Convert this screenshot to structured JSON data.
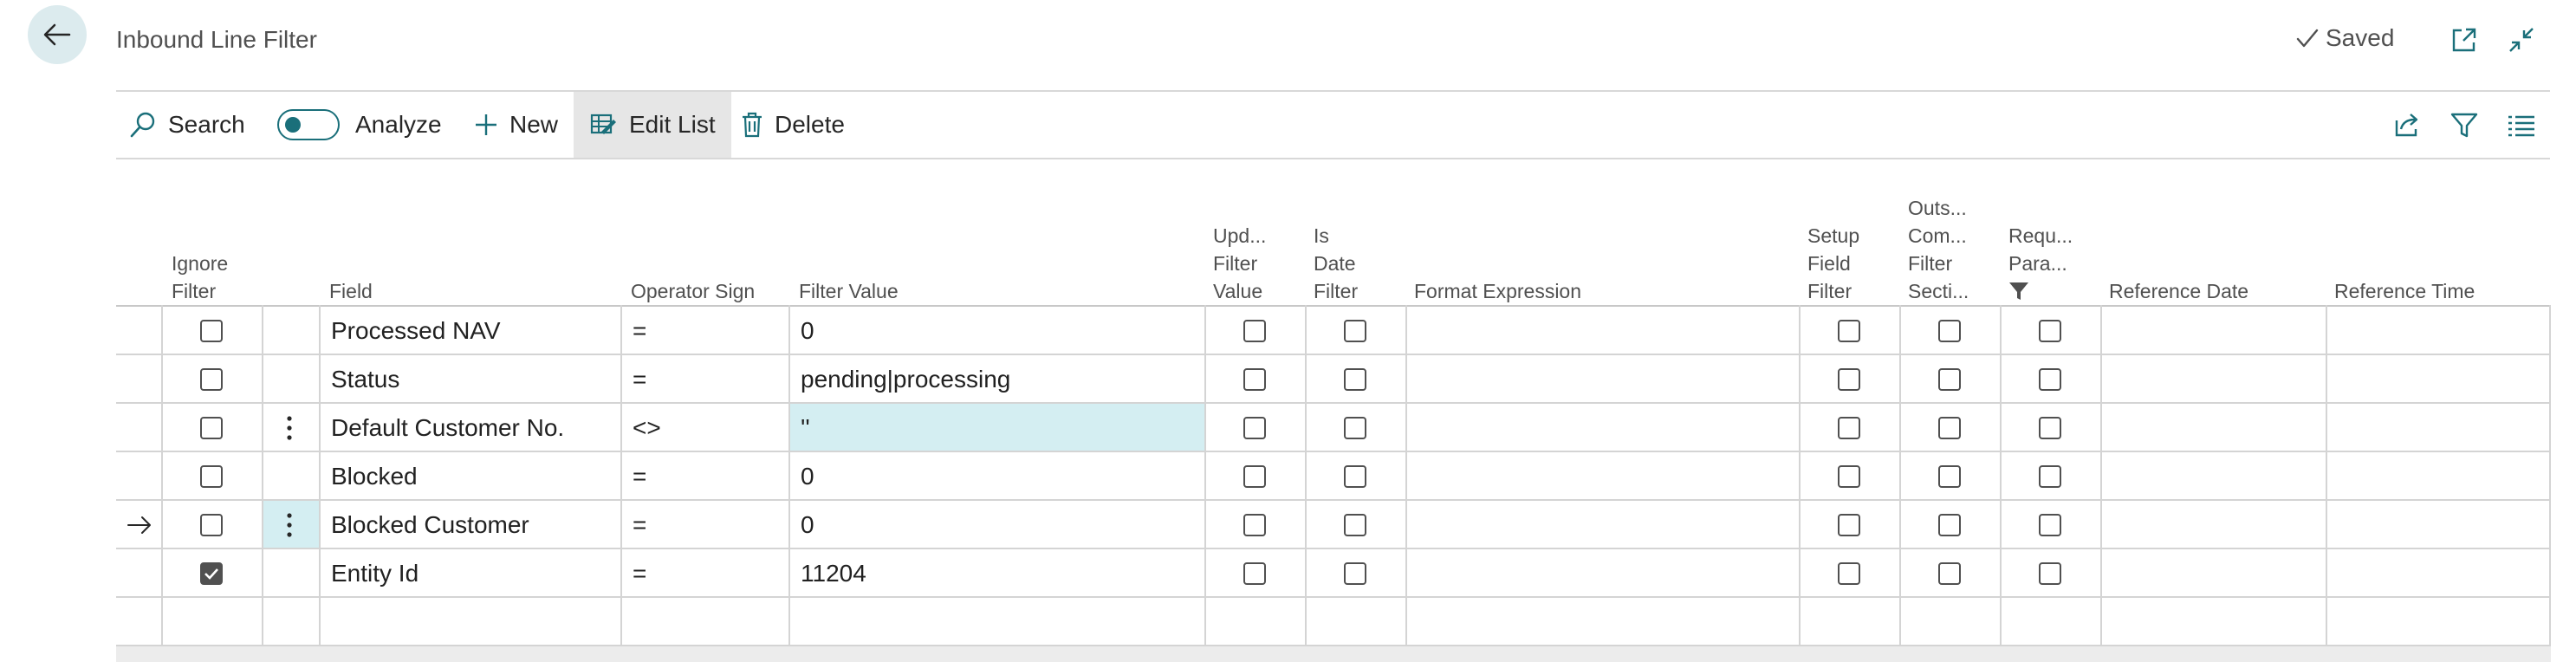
{
  "header": {
    "title": "Inbound Line Filter",
    "saved_label": "Saved"
  },
  "toolbar": {
    "search_label": "Search",
    "analyze_label": "Analyze",
    "new_label": "New",
    "edit_list_label": "Edit List",
    "delete_label": "Delete"
  },
  "columns": {
    "ignore_filter": [
      "Ignore",
      "Filter"
    ],
    "field": [
      "Field"
    ],
    "operator_sign": [
      "Operator Sign"
    ],
    "filter_value": [
      "Filter Value"
    ],
    "upd_filter_value": [
      "Upd...",
      "Filter",
      "Value"
    ],
    "is_date_filter": [
      "Is",
      "Date",
      "Filter"
    ],
    "format_expression": [
      "Format Expression"
    ],
    "setup_field_filter": [
      "Setup",
      "Field",
      "Filter"
    ],
    "outs_com_filter": [
      "Outs...",
      "Com...",
      "Filter",
      "Secti..."
    ],
    "requ_para": [
      "Requ...",
      "Para..."
    ],
    "reference_date": [
      "Reference Date"
    ],
    "reference_time": [
      "Reference Time"
    ]
  },
  "rows": [
    {
      "field": "Processed NAV",
      "operator": "=",
      "filter_value": "0",
      "ignore_filter": false,
      "current": false,
      "selected": false
    },
    {
      "field": "Status",
      "operator": "=",
      "filter_value": "pending|processing",
      "ignore_filter": false,
      "current": false,
      "selected": false
    },
    {
      "field": "Default Customer No.",
      "operator": "<>",
      "filter_value": "''",
      "ignore_filter": false,
      "current": false,
      "selected": true
    },
    {
      "field": "Blocked",
      "operator": "=",
      "filter_value": "0",
      "ignore_filter": false,
      "current": false,
      "selected": false
    },
    {
      "field": "Blocked Customer",
      "operator": "=",
      "filter_value": "0",
      "ignore_filter": false,
      "current": true,
      "selected": false
    },
    {
      "field": "Entity Id",
      "operator": "=",
      "filter_value": "11204",
      "ignore_filter": true,
      "current": false,
      "selected": false
    }
  ],
  "colors": {
    "accent": "#1a6f7a",
    "selection_fill": "#d4eef2",
    "back_button_fill": "#dcebee"
  },
  "icons": {
    "back": "arrow-left-icon",
    "saved": "checkmark-icon",
    "open_new_window": "open-in-new-window-icon",
    "collapse": "collapse-icon",
    "search": "search-icon",
    "new": "plus-icon",
    "edit_list": "edit-list-icon",
    "delete": "trash-icon",
    "share": "share-icon",
    "filter": "funnel-icon",
    "list_view": "list-view-icon",
    "row_actions": "vertical-ellipsis-icon",
    "current_row": "arrow-right-icon"
  }
}
